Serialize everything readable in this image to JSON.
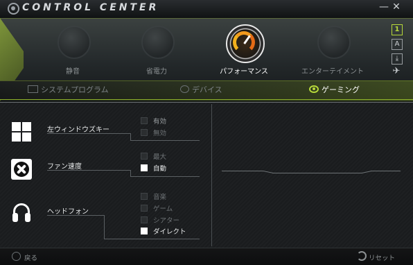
{
  "window": {
    "title": "CONTROL CENTER",
    "minimize_glyph": "—",
    "close_glyph": "✕"
  },
  "modes": [
    {
      "label": "静音",
      "icon": "speaker-icon"
    },
    {
      "label": "省電力",
      "icon": "fan-blade-icon"
    },
    {
      "label": "パフォーマンス",
      "icon": "gauge-icon",
      "active": true
    },
    {
      "label": "エンターテイメント",
      "icon": "crosshair-icon"
    }
  ],
  "side_icons": {
    "one": "1",
    "a": "A",
    "download": "⤓",
    "plane": "✈"
  },
  "categories": {
    "system": "システムプログラム",
    "device": "デバイス",
    "gaming": "ゲーミング"
  },
  "active_category": "gaming",
  "sections": {
    "windows_key": {
      "label": "左ウィンドウズキー",
      "options": [
        {
          "label": "有効",
          "checked": false
        },
        {
          "label": "無効",
          "checked": false
        }
      ]
    },
    "fan_speed": {
      "label": "ファン速度",
      "options": [
        {
          "label": "最大",
          "checked": false
        },
        {
          "label": "自動",
          "checked": true
        }
      ]
    },
    "headphones": {
      "label": "ヘッドフォン",
      "options": [
        {
          "label": "音楽",
          "checked": false
        },
        {
          "label": "ゲーム",
          "checked": false
        },
        {
          "label": "シアター",
          "checked": false
        },
        {
          "label": "ダイレクト",
          "checked": true
        }
      ]
    }
  },
  "footer": {
    "back": "戻る",
    "reset": "リセット"
  },
  "colors": {
    "accent": "#b7d93a",
    "gauge": "#f29a1d"
  }
}
